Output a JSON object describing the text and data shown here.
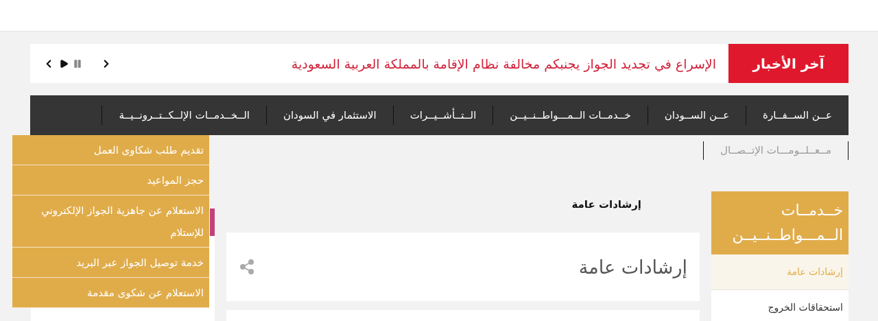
{
  "news": {
    "label": "آخر الأخبار",
    "headline": "الإسراع في تجديد الجواز يجنبكم مخالفة نظام الإقامة بالمملكة العربية السعودية",
    "playing": true
  },
  "nav": {
    "items": [
      {
        "label": "عــن الســفــارة"
      },
      {
        "label": "عــن الســودان"
      },
      {
        "label": "خــدمــات الــمـــواطــنــيــن"
      },
      {
        "label": "الــتــأشــيــرات"
      },
      {
        "label": "الاستثمار في السودان"
      },
      {
        "label": "الــخــدمــات الإلــكــتــرونــيــة",
        "children": [
          "تقديم طلب شكاوى العمل",
          "حجز المواعيد",
          "الاستعلام عن جاهزية الجواز الإلكتروني للإستلام",
          "خدمة توصيل الجواز عبر البريد",
          "الاستعلام عن شكوى مقدمة"
        ]
      }
    ],
    "second_row": [
      "مــعــلــومـــات الإتــصــال"
    ]
  },
  "sidebar": {
    "title": "خــدمــات الــمـــواطــنــيــن",
    "items": [
      {
        "label": "إرشادات عامة",
        "selected": true
      },
      {
        "label": "استحقاقات الخروج",
        "selected": false
      }
    ]
  },
  "breadcrumb": "إرشادات عامة",
  "article": {
    "title": "إرشادات عامة"
  }
}
